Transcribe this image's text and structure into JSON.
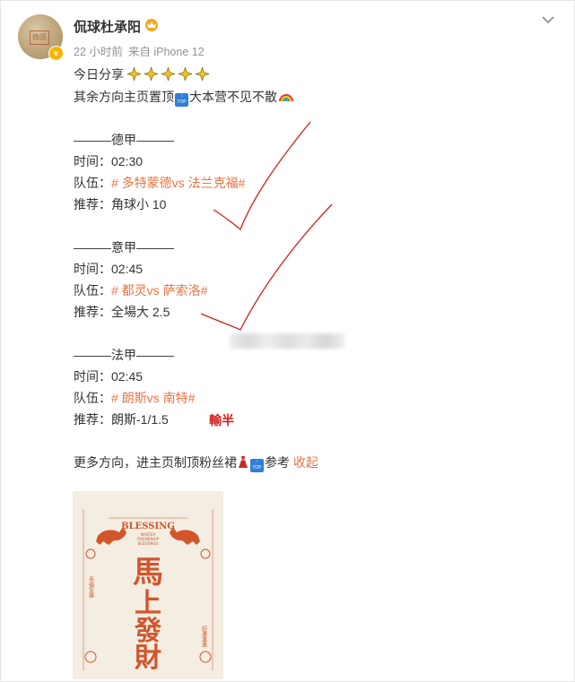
{
  "post": {
    "username": "侃球杜承阳",
    "time": "22 小时前",
    "source": "来自 iPhone 12",
    "line_share": "今日分享",
    "line_direction": "其余方向主页置顶",
    "line_direction_tail": "大本营不见不散",
    "top_icon_text": "TOP",
    "avatar_stamp": "微国",
    "verified_mark": "v"
  },
  "matches": [
    {
      "league_line": "———德甲———",
      "time_label": "时间：",
      "time_value": "02:30",
      "team_label": "队伍：",
      "team_tag": "# 多特蒙德vs 法兰克福#",
      "rec_label": "推荐：",
      "rec_value": "角球小 10"
    },
    {
      "league_line": "———意甲———",
      "time_label": "时间：",
      "time_value": "02:45",
      "team_label": "队伍：",
      "team_tag": "# 都灵vs 萨索洛#",
      "rec_label": "推荐：",
      "rec_value": "全場大 2.5"
    },
    {
      "league_line": "———法甲———",
      "time_label": "时间：",
      "time_value": "02:45",
      "team_label": "队伍：",
      "team_tag": "# 朗斯vs 南特#",
      "rec_label": "推荐：",
      "rec_value": "朗斯-1/1.5"
    }
  ],
  "handwritten_note": "輸半",
  "more": {
    "text": "更多方向，进主页制顶粉丝裙",
    "tail": "参考",
    "collapse": "收起"
  },
  "poster": {
    "title": "BLESSING",
    "subtitle_1": "MASTER",
    "subtitle_2": "FRIENDSHIP",
    "subtitle_3": "BLESSINGS",
    "big_text": [
      "馬",
      "上",
      "發",
      "財"
    ],
    "side_left": "幸福安康",
    "side_right": "好運連連"
  },
  "colors": {
    "accent": "#eb7340",
    "note_red": "#d11e1e",
    "verified": "#f7b500",
    "top_icon": "#2f7ed8",
    "poster_red": "#d2552c"
  }
}
